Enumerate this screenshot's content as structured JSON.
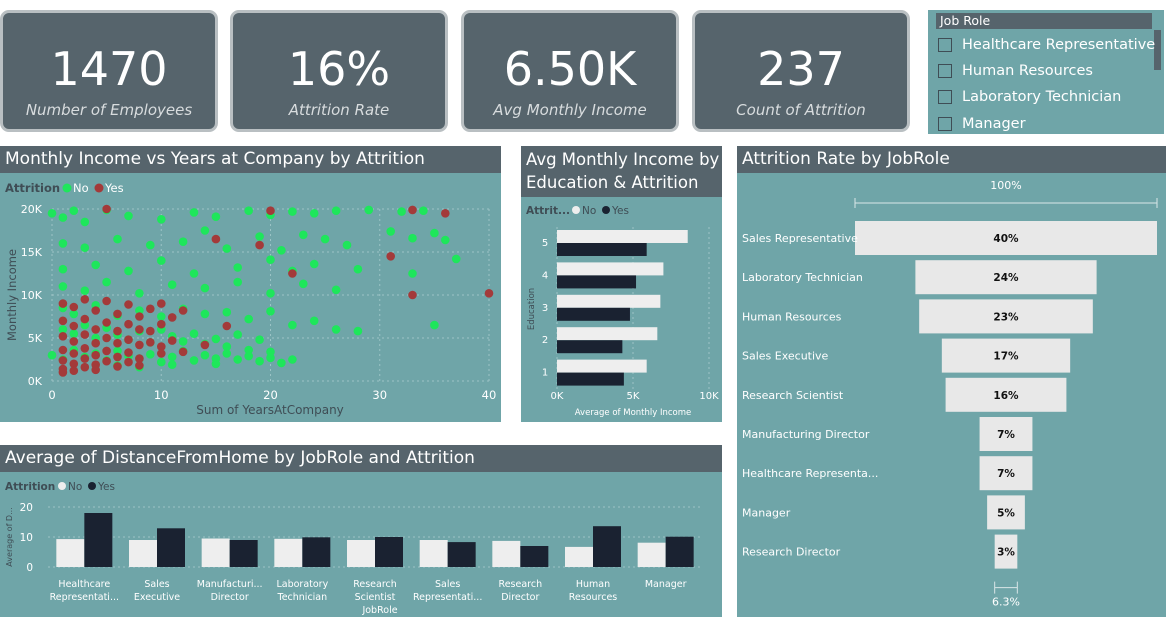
{
  "kpis": [
    {
      "value": "1470",
      "label": "Number of Employees"
    },
    {
      "value": "16%",
      "label": "Attrition Rate"
    },
    {
      "value": "6.50K",
      "label": "Avg Monthly Income"
    },
    {
      "value": "237",
      "label": "Count of Attrition"
    }
  ],
  "slicer": {
    "title": "Job Role",
    "items": [
      "Healthcare Representative",
      "Human Resources",
      "Laboratory Technician",
      "Manager"
    ]
  },
  "colors": {
    "no_green": "#1ee65b",
    "yes_red": "#a33a3a",
    "no_light": "#eeeeee",
    "yes_dark": "#1a2231",
    "panel": "#6fa5a8",
    "header": "#56646c"
  },
  "scatter_title": "Monthly Income vs Years at Company by Attrition",
  "edu_title_line1": "Avg Monthly Income by",
  "edu_title_line2": "Education & Attrition",
  "funnel_title": "Attrition Rate by JobRole",
  "distance_title": "Average of DistanceFromHome by JobRole and Attrition",
  "chart_data": [
    {
      "type": "scatter",
      "title": "Monthly Income vs Years at Company by Attrition",
      "legend_title": "Attrition",
      "legend": [
        "No",
        "Yes"
      ],
      "xlabel": "Sum of YearsAtCompany",
      "ylabel": "Monthly Income",
      "xlim": [
        0,
        40
      ],
      "ylim": [
        0,
        20000
      ],
      "xticks": [
        "0",
        "10",
        "20",
        "30",
        "40"
      ],
      "yticks": [
        "0K",
        "5K",
        "10K",
        "15K",
        "20K"
      ],
      "series": [
        {
          "name": "No",
          "points": [
            [
              0,
              19500
            ],
            [
              1,
              19000
            ],
            [
              2,
              19800
            ],
            [
              3,
              18500
            ],
            [
              5,
              19900
            ],
            [
              7,
              19200
            ],
            [
              10,
              18800
            ],
            [
              13,
              19600
            ],
            [
              15,
              19100
            ],
            [
              18,
              19800
            ],
            [
              20,
              19300
            ],
            [
              22,
              19700
            ],
            [
              24,
              19500
            ],
            [
              26,
              19800
            ],
            [
              29,
              19900
            ],
            [
              32,
              19700
            ],
            [
              34,
              19800
            ],
            [
              1,
              16000
            ],
            [
              3,
              15500
            ],
            [
              6,
              16500
            ],
            [
              9,
              15800
            ],
            [
              12,
              16200
            ],
            [
              14,
              17500
            ],
            [
              16,
              15400
            ],
            [
              19,
              16800
            ],
            [
              21,
              15200
            ],
            [
              23,
              17000
            ],
            [
              25,
              16500
            ],
            [
              27,
              15800
            ],
            [
              31,
              17400
            ],
            [
              33,
              16600
            ],
            [
              35,
              17200
            ],
            [
              36,
              16400
            ],
            [
              1,
              13000
            ],
            [
              4,
              13500
            ],
            [
              7,
              12800
            ],
            [
              10,
              14000
            ],
            [
              13,
              12500
            ],
            [
              17,
              13200
            ],
            [
              20,
              14100
            ],
            [
              22,
              12800
            ],
            [
              24,
              13600
            ],
            [
              28,
              13000
            ],
            [
              33,
              12500
            ],
            [
              37,
              14200
            ],
            [
              1,
              11000
            ],
            [
              3,
              10500
            ],
            [
              5,
              11500
            ],
            [
              8,
              10200
            ],
            [
              11,
              11200
            ],
            [
              14,
              10800
            ],
            [
              17,
              11500
            ],
            [
              20,
              10200
            ],
            [
              23,
              11300
            ],
            [
              26,
              10600
            ],
            [
              1,
              8500
            ],
            [
              2,
              7800
            ],
            [
              4,
              8800
            ],
            [
              6,
              7600
            ],
            [
              8,
              8200
            ],
            [
              10,
              7500
            ],
            [
              12,
              8400
            ],
            [
              14,
              7800
            ],
            [
              16,
              8000
            ],
            [
              18,
              7200
            ],
            [
              20,
              8100
            ],
            [
              22,
              6500
            ],
            [
              24,
              7000
            ],
            [
              26,
              6000
            ],
            [
              28,
              5800
            ],
            [
              35,
              6500
            ],
            [
              1,
              6000
            ],
            [
              2,
              5500
            ],
            [
              3,
              6500
            ],
            [
              4,
              5000
            ],
            [
              5,
              6200
            ],
            [
              6,
              5400
            ],
            [
              7,
              4800
            ],
            [
              8,
              5800
            ],
            [
              9,
              4500
            ],
            [
              10,
              6000
            ],
            [
              11,
              5200
            ],
            [
              12,
              4600
            ],
            [
              13,
              5500
            ],
            [
              14,
              4300
            ],
            [
              15,
              4900
            ],
            [
              16,
              4000
            ],
            [
              17,
              5400
            ],
            [
              18,
              3600
            ],
            [
              19,
              4800
            ],
            [
              20,
              3400
            ],
            [
              0,
              3000
            ],
            [
              1,
              2500
            ],
            [
              2,
              3600
            ],
            [
              3,
              2800
            ],
            [
              4,
              3200
            ],
            [
              5,
              2400
            ],
            [
              6,
              3500
            ],
            [
              7,
              2900
            ],
            [
              8,
              2600
            ],
            [
              9,
              3100
            ],
            [
              10,
              2200
            ],
            [
              11,
              2800
            ],
            [
              12,
              3500
            ],
            [
              13,
              2400
            ],
            [
              14,
              3000
            ],
            [
              15,
              2600
            ],
            [
              16,
              3200
            ],
            [
              17,
              2500
            ],
            [
              18,
              2900
            ],
            [
              19,
              2300
            ],
            [
              20,
              2700
            ],
            [
              21,
              2100
            ],
            [
              22,
              2500
            ],
            [
              6,
              1800
            ],
            [
              8,
              1600
            ],
            [
              11,
              1900
            ],
            [
              15,
              2000
            ]
          ]
        },
        {
          "name": "Yes",
          "points": [
            [
              5,
              20000
            ],
            [
              20,
              19800
            ],
            [
              33,
              19900
            ],
            [
              36,
              19500
            ],
            [
              15,
              16500
            ],
            [
              19,
              15800
            ],
            [
              31,
              14500
            ],
            [
              22,
              12500
            ],
            [
              33,
              10000
            ],
            [
              40,
              10200
            ],
            [
              1,
              9000
            ],
            [
              2,
              8600
            ],
            [
              3,
              9500
            ],
            [
              4,
              8200
            ],
            [
              5,
              9300
            ],
            [
              6,
              7800
            ],
            [
              7,
              8900
            ],
            [
              8,
              7500
            ],
            [
              9,
              8400
            ],
            [
              10,
              9000
            ],
            [
              11,
              7400
            ],
            [
              12,
              8200
            ],
            [
              16,
              6400
            ],
            [
              1,
              7000
            ],
            [
              2,
              6400
            ],
            [
              3,
              7200
            ],
            [
              4,
              6000
            ],
            [
              5,
              6800
            ],
            [
              6,
              5800
            ],
            [
              7,
              6600
            ],
            [
              8,
              6000
            ],
            [
              9,
              5800
            ],
            [
              10,
              6600
            ],
            [
              1,
              5200
            ],
            [
              2,
              4600
            ],
            [
              3,
              5400
            ],
            [
              4,
              4400
            ],
            [
              5,
              5000
            ],
            [
              6,
              4400
            ],
            [
              7,
              4800
            ],
            [
              8,
              4200
            ],
            [
              9,
              4500
            ],
            [
              10,
              4000
            ],
            [
              11,
              4700
            ],
            [
              14,
              4200
            ],
            [
              1,
              3600
            ],
            [
              2,
              3200
            ],
            [
              3,
              3800
            ],
            [
              4,
              3000
            ],
            [
              5,
              3500
            ],
            [
              6,
              2800
            ],
            [
              7,
              3300
            ],
            [
              8,
              2600
            ],
            [
              10,
              3200
            ],
            [
              12,
              3400
            ],
            [
              1,
              2400
            ],
            [
              2,
              2000
            ],
            [
              3,
              2600
            ],
            [
              4,
              1900
            ],
            [
              5,
              2300
            ],
            [
              6,
              1700
            ],
            [
              7,
              2200
            ],
            [
              8,
              1800
            ],
            [
              1,
              1400
            ],
            [
              2,
              1200
            ],
            [
              3,
              1600
            ],
            [
              4,
              1300
            ],
            [
              1,
              1000
            ]
          ]
        }
      ]
    },
    {
      "type": "bar",
      "orientation": "horizontal",
      "title": "Avg Monthly Income by Education & Attrition",
      "legend_title": "Attrit...",
      "legend": [
        "No",
        "Yes"
      ],
      "xlabel": "Average of Monthly Income",
      "ylabel": "Education",
      "xlim": [
        0,
        10000
      ],
      "xticks": [
        "0K",
        "5K",
        "10K"
      ],
      "categories": [
        "5",
        "4",
        "3",
        "2",
        "1"
      ],
      "series": [
        {
          "name": "No",
          "values": [
            8600,
            7000,
            6800,
            6600,
            5900
          ]
        },
        {
          "name": "Yes",
          "values": [
            5900,
            5200,
            4800,
            4300,
            4400
          ]
        }
      ]
    },
    {
      "type": "bar",
      "subtype": "funnel",
      "title": "Attrition Rate by JobRole",
      "top_label": "100%",
      "bottom_label": "6.3%",
      "categories": [
        "Sales Representative",
        "Laboratory Technician",
        "Human Resources",
        "Sales Executive",
        "Research Scientist",
        "Manufacturing Director",
        "Healthcare Representa...",
        "Manager",
        "Research Director"
      ],
      "values": [
        40,
        24,
        23,
        17,
        16,
        7,
        7,
        5,
        3
      ],
      "value_labels": [
        "40%",
        "24%",
        "23%",
        "17%",
        "16%",
        "7%",
        "7%",
        "5%",
        "3%"
      ]
    },
    {
      "type": "bar",
      "title": "Average of DistanceFromHome by JobRole and Attrition",
      "legend_title": "Attrition",
      "legend": [
        "No",
        "Yes"
      ],
      "xlabel": "JobRole",
      "ylabel": "Average of D...",
      "ylim": [
        0,
        20
      ],
      "yticks": [
        "0",
        "10",
        "20"
      ],
      "categories": [
        [
          "Healthcare",
          "Representati..."
        ],
        [
          "Sales",
          "Executive"
        ],
        [
          "Manufacturi...",
          "Director"
        ],
        [
          "Laboratory",
          "Technician"
        ],
        [
          "Research",
          "Scientist"
        ],
        [
          "Sales",
          "Representati..."
        ],
        [
          "Research",
          "Director"
        ],
        [
          "Human",
          "Resources"
        ],
        [
          "Manager"
        ]
      ],
      "series": [
        {
          "name": "No",
          "values": [
            9.3,
            9.0,
            9.5,
            9.4,
            9.0,
            9.0,
            8.7,
            6.7,
            8.1
          ]
        },
        {
          "name": "Yes",
          "values": [
            18.0,
            12.9,
            9.0,
            9.9,
            10.0,
            8.3,
            7.0,
            13.6,
            10.1
          ]
        }
      ]
    }
  ]
}
